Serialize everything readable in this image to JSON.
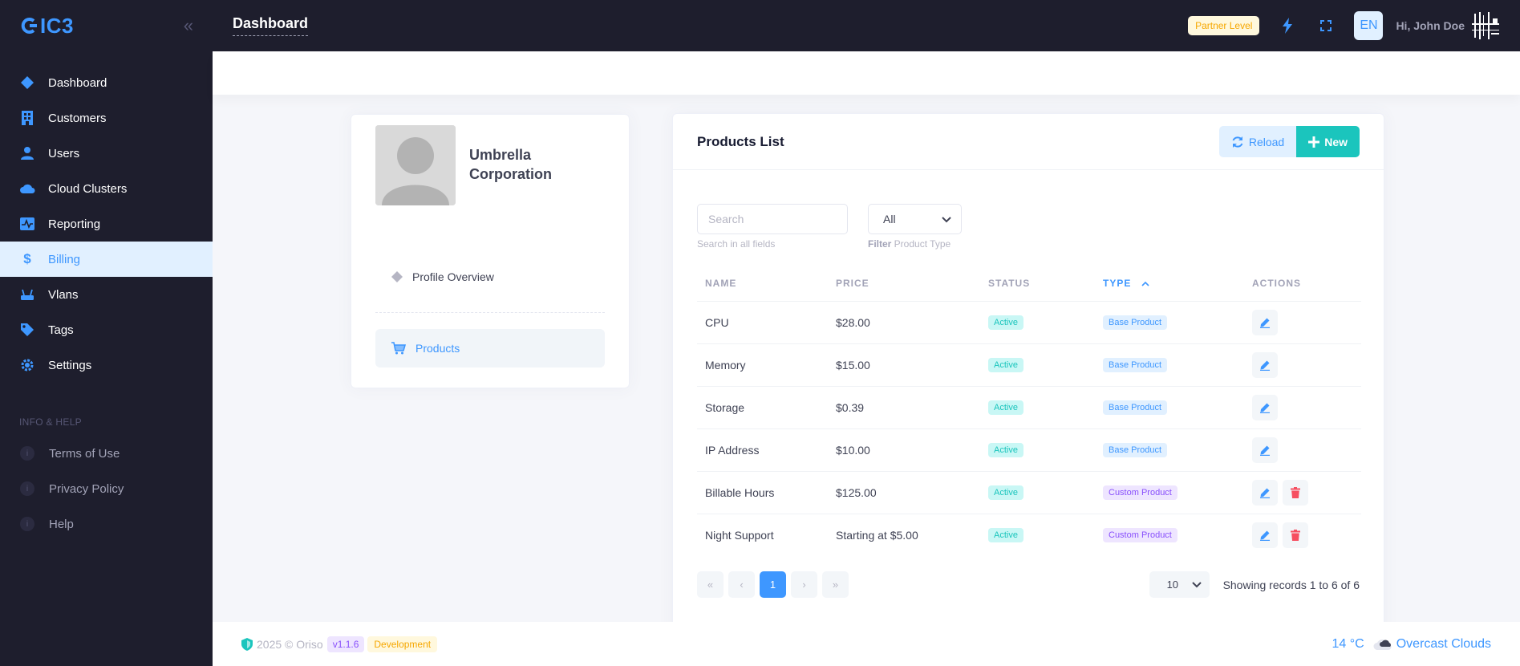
{
  "brand": {
    "logo_text": "IC3",
    "accent": "#3e97ff"
  },
  "sidebar": {
    "items": [
      {
        "label": "Dashboard",
        "icon": "diamond-icon"
      },
      {
        "label": "Customers",
        "icon": "building-icon"
      },
      {
        "label": "Users",
        "icon": "user-icon"
      },
      {
        "label": "Cloud Clusters",
        "icon": "cloud-icon"
      },
      {
        "label": "Reporting",
        "icon": "chart-icon"
      },
      {
        "label": "Billing",
        "icon": "dollar-icon",
        "active": true
      },
      {
        "label": "Vlans",
        "icon": "router-icon"
      },
      {
        "label": "Tags",
        "icon": "tag-icon"
      },
      {
        "label": "Settings",
        "icon": "gear-icon"
      }
    ],
    "section_title": "INFO & HELP",
    "help_items": [
      {
        "label": "Terms of Use"
      },
      {
        "label": "Privacy Policy"
      },
      {
        "label": "Help"
      }
    ]
  },
  "header": {
    "title": "Dashboard",
    "partner_badge": "Partner Level",
    "lang": "EN",
    "greeting": "Hi, John Doe"
  },
  "profile": {
    "name": "Umbrella Corporation",
    "nav": [
      {
        "label": "Profile Overview"
      },
      {
        "label": "Products",
        "active": true
      }
    ]
  },
  "products": {
    "title": "Products List",
    "reload_label": "Reload",
    "new_label": "New",
    "search_placeholder": "Search",
    "search_hint": "Search in all fields",
    "filter_value": "All",
    "filter_hint_bold": "Filter",
    "filter_hint_rest": " Product Type",
    "columns": [
      "Name",
      "Price",
      "Status",
      "Type",
      "Actions"
    ],
    "rows": [
      {
        "name": "CPU",
        "price": "$28.00",
        "status": "Active",
        "type": "Base Product",
        "type_kind": "base",
        "deletable": false
      },
      {
        "name": "Memory",
        "price": "$15.00",
        "status": "Active",
        "type": "Base Product",
        "type_kind": "base",
        "deletable": false
      },
      {
        "name": "Storage",
        "price": "$0.39",
        "status": "Active",
        "type": "Base Product",
        "type_kind": "base",
        "deletable": false
      },
      {
        "name": "IP Address",
        "price": "$10.00",
        "status": "Active",
        "type": "Base Product",
        "type_kind": "base",
        "deletable": false
      },
      {
        "name": "Billable Hours",
        "price": "$125.00",
        "status": "Active",
        "type": "Custom Product",
        "type_kind": "custom",
        "deletable": true
      },
      {
        "name": "Night Support",
        "price": "Starting at $5.00",
        "status": "Active",
        "type": "Custom Product",
        "type_kind": "custom",
        "deletable": true
      }
    ],
    "pagination": {
      "current_page": "1",
      "page_size": "10",
      "records_text": "Showing records 1 to 6 of 6"
    }
  },
  "footer": {
    "copyright": "2025 © Oriso",
    "version": "v1.1.6",
    "environment": "Development",
    "temperature": "14 °C",
    "weather": "Overcast Clouds"
  }
}
